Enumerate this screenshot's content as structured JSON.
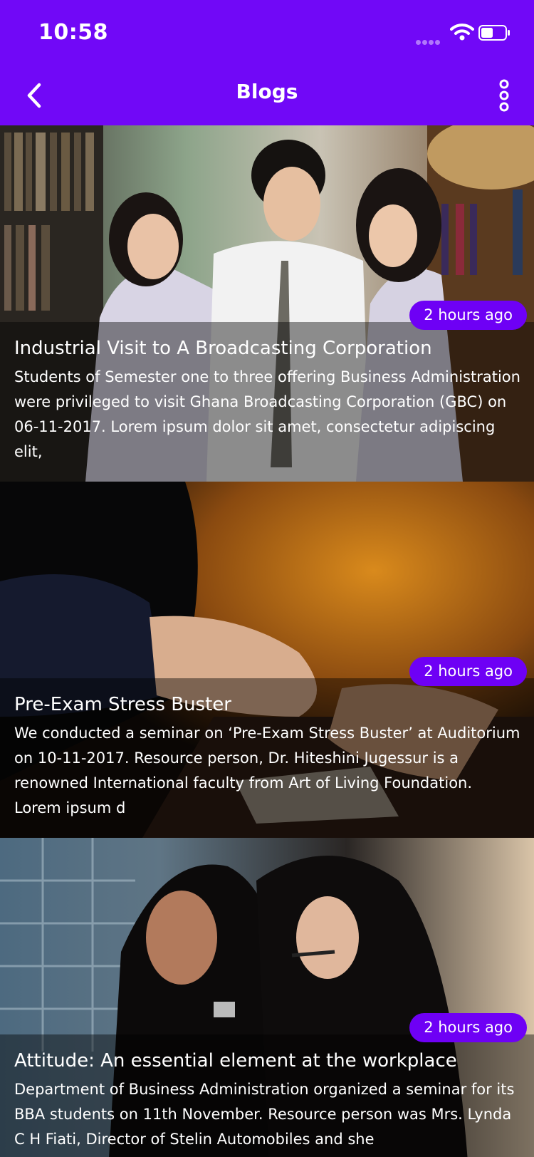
{
  "status_bar": {
    "time": "10:58"
  },
  "header": {
    "title": "Blogs",
    "back_icon": "chevron-left-icon",
    "menu_icon": "more-vertical-icon"
  },
  "colors": {
    "primary": "#7108F7",
    "badge": "#6E00F5"
  },
  "posts": [
    {
      "time_ago": "2 hours ago",
      "title": "Industrial Visit to A Broadcasting Corporation",
      "excerpt": "Students of Semester one to three offering Business Administration were privileged to visit Ghana Broadcasting Corporation (GBC) on 06-11-2017. Lorem ipsum dolor sit amet, consectetur adipiscing elit,"
    },
    {
      "time_ago": "2 hours ago",
      "title": "Pre-Exam Stress Buster",
      "excerpt": "We conducted a seminar on ‘Pre-Exam Stress Buster’ at Auditorium on 10-11-2017. Resource person, Dr. Hiteshini Jugessur is a renowned International faculty from Art of Living Foundation. Lorem ipsum d"
    },
    {
      "time_ago": "2 hours ago",
      "title": "Attitude: An essential element at the workplace",
      "excerpt": "Department of Business Administration organized a seminar for its BBA students on 11th November. Resource person was Mrs. Lynda C H Fiati, Director of Stelin Automobiles and she"
    }
  ]
}
